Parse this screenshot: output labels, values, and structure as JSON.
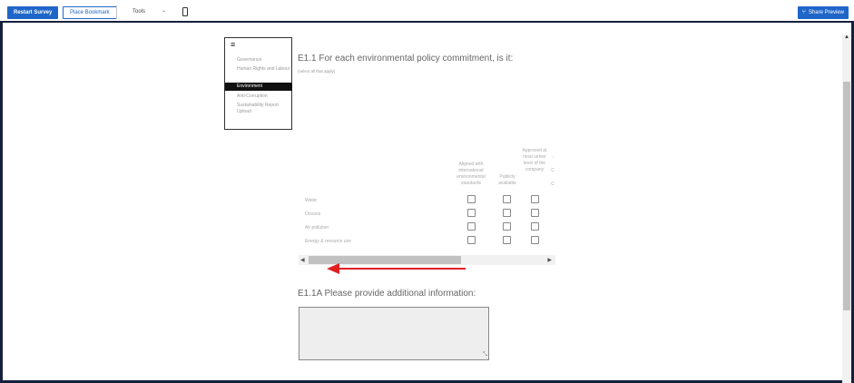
{
  "toolbar": {
    "restart_label": "Restart Survey",
    "bookmark_label": "Place Bookmark",
    "tools_label": "Tools",
    "tools_chevron": "⌄",
    "share_label": "Share Preview",
    "share_icon": "share-icon"
  },
  "toc": {
    "menu_icon": "≡",
    "items": [
      {
        "label": "Governance"
      },
      {
        "label": "Human Rights and Labour"
      },
      {
        "label": "Environment",
        "active": true
      },
      {
        "label": "Anti-Corruption"
      },
      {
        "label": "Sustainability Report Upload"
      }
    ]
  },
  "question1": {
    "title": "E1.1 For each environmental policy commitment, is it:",
    "instruction": "(select all that apply)",
    "columns": [
      "Aligned with international environmental standards",
      "Publicly available",
      "Approved at most senior level of the company"
    ],
    "rows": [
      "Water",
      "Oceans",
      "Air pollution",
      "Energy & resource use"
    ],
    "partial_column_fragments": [
      ":",
      "C",
      "C"
    ]
  },
  "scrollbar": {
    "left_arrow": "◀",
    "right_arrow": "▶"
  },
  "question2": {
    "title": "E1.1A Please provide additional information:",
    "value": ""
  },
  "colors": {
    "accent": "#1f66c8",
    "frame": "#14213d",
    "annotation_arrow": "#e02020"
  }
}
